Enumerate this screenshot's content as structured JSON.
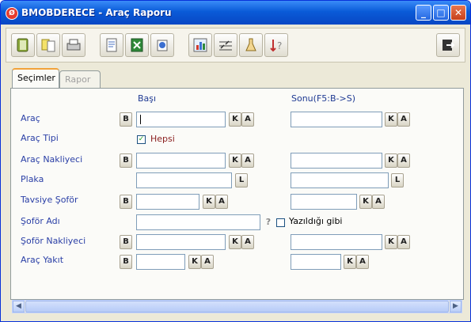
{
  "window": {
    "title": "BMOBDERECE - Araç Raporu",
    "minimize": "_",
    "maximize": "□",
    "close": "✕"
  },
  "tabs": [
    {
      "label": "Seçimler",
      "active": true
    },
    {
      "label": "Rapor",
      "active": false
    }
  ],
  "columns": {
    "start": "Başı",
    "end": "Sonu(F5:B->S)"
  },
  "rows": [
    {
      "label": "Araç"
    },
    {
      "label": "Araç Tipi"
    },
    {
      "label": "Araç Nakliyeci"
    },
    {
      "label": "Plaka"
    },
    {
      "label": "Tavsiye Şoför"
    },
    {
      "label": "Şoför Adı"
    },
    {
      "label": "Şoför Nakliyeci"
    },
    {
      "label": "Araç Yakıt"
    }
  ],
  "all_checkbox": {
    "label": "Hepsi",
    "checked": true
  },
  "exact_checkbox": {
    "label": "Yazıldığı gibi",
    "checked": false
  },
  "button_labels": {
    "browse": "B",
    "code": "K",
    "name": "A",
    "list": "L",
    "help": "?"
  },
  "colors": {
    "titlebar": "#0a5bd8",
    "label": "#2a3fa6",
    "accent_tab": "#f2a23a"
  },
  "icons": [
    "book-icon",
    "documents-icon",
    "printer-icon",
    "report-icon",
    "excel-icon",
    "export-icon",
    "chart-icon",
    "signature-icon",
    "flask-icon",
    "sort-help-icon",
    "exit-icon"
  ]
}
